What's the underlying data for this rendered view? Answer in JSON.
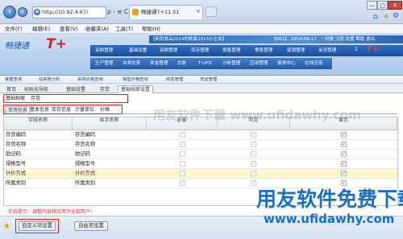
{
  "browser": {
    "url": "http://10.92.4.67/",
    "address_buttons": "ρ - ≡ C ×",
    "tab_title": "畅捷通T+11.51",
    "tab_close": "×",
    "window_buttons": [
      "—",
      "□",
      "✕"
    ]
  },
  "menubar": {
    "items": [
      "文件(F)",
      "编辑(E)",
      "查看(V)",
      "收藏夹(A)",
      "工具(T)",
      "帮助(H)"
    ]
  },
  "app": {
    "logo_text": "畅捷通",
    "logo_mark": "T+",
    "info_company": "【新阳食品2014的账套2013小企业】",
    "info_code": "【001】",
    "info_date": "2014-06-17",
    "info_right": "! 切换  注销  设置  帮助  退出",
    "nav_row1": [
      "采购管理",
      "基础设置",
      "采购管理",
      "库存管理",
      "销售管理",
      "零售管理",
      "促销管理",
      "会员管理"
    ],
    "nav_row2": [
      "生产管理",
      "业务往来",
      "资金管理",
      "总账",
      "T-UFO",
      "分析管理",
      "应用管理",
      "报表中心",
      "在线应用"
    ],
    "status": "1",
    "brand": "T+"
  },
  "crumbs": [
    "单据查询",
    "往来账分析",
    "采购价格查询",
    "销售价格查询",
    "收发管理",
    "凭证管理"
  ],
  "tabs": [
    "首页",
    "初始化导航",
    "基础设置",
    "存货",
    "基础档案设置"
  ],
  "selector": {
    "label": "基础档案",
    "value": "存货"
  },
  "inner_tabs": [
    "常用信息",
    "基本信息",
    "库存信息",
    "计量单位",
    "价格"
  ],
  "grid": {
    "headers": [
      "字段名称",
      "显示名称",
      "必录",
      "可见",
      "显示"
    ],
    "rows": [
      {
        "field": "存货编码",
        "display": "存货编码",
        "required": true,
        "editable": true,
        "show": true,
        "hl": false
      },
      {
        "field": "存货名称",
        "display": "存货名称",
        "required": true,
        "editable": true,
        "show": true,
        "hl": false
      },
      {
        "field": "助记码",
        "display": "助记码",
        "required": false,
        "editable": true,
        "show": true,
        "hl": false
      },
      {
        "field": "规格型号",
        "display": "规格型号",
        "required": false,
        "editable": true,
        "show": true,
        "hl": false
      },
      {
        "field": "计价方式",
        "display": "计价方式",
        "required": true,
        "editable": true,
        "show": true,
        "hl": true
      },
      {
        "field": "所属类别",
        "display": "所属类别",
        "required": true,
        "editable": true,
        "show": true,
        "hl": false
      }
    ]
  },
  "hint": "在线提示：调整内容将应用于全部用户!",
  "buttons": {
    "custom": "自定义项设置",
    "free": "自由项设置"
  },
  "watermarks": {
    "center": "用友软件下载 www.ufidawhy.com",
    "brand": "用友软件免费下载",
    "url": "www.ufidawhy.com"
  },
  "colors": {
    "accent": "#1f56a8",
    "highlight_box": "#d32a20",
    "row_highlight": "#fff6d0"
  }
}
